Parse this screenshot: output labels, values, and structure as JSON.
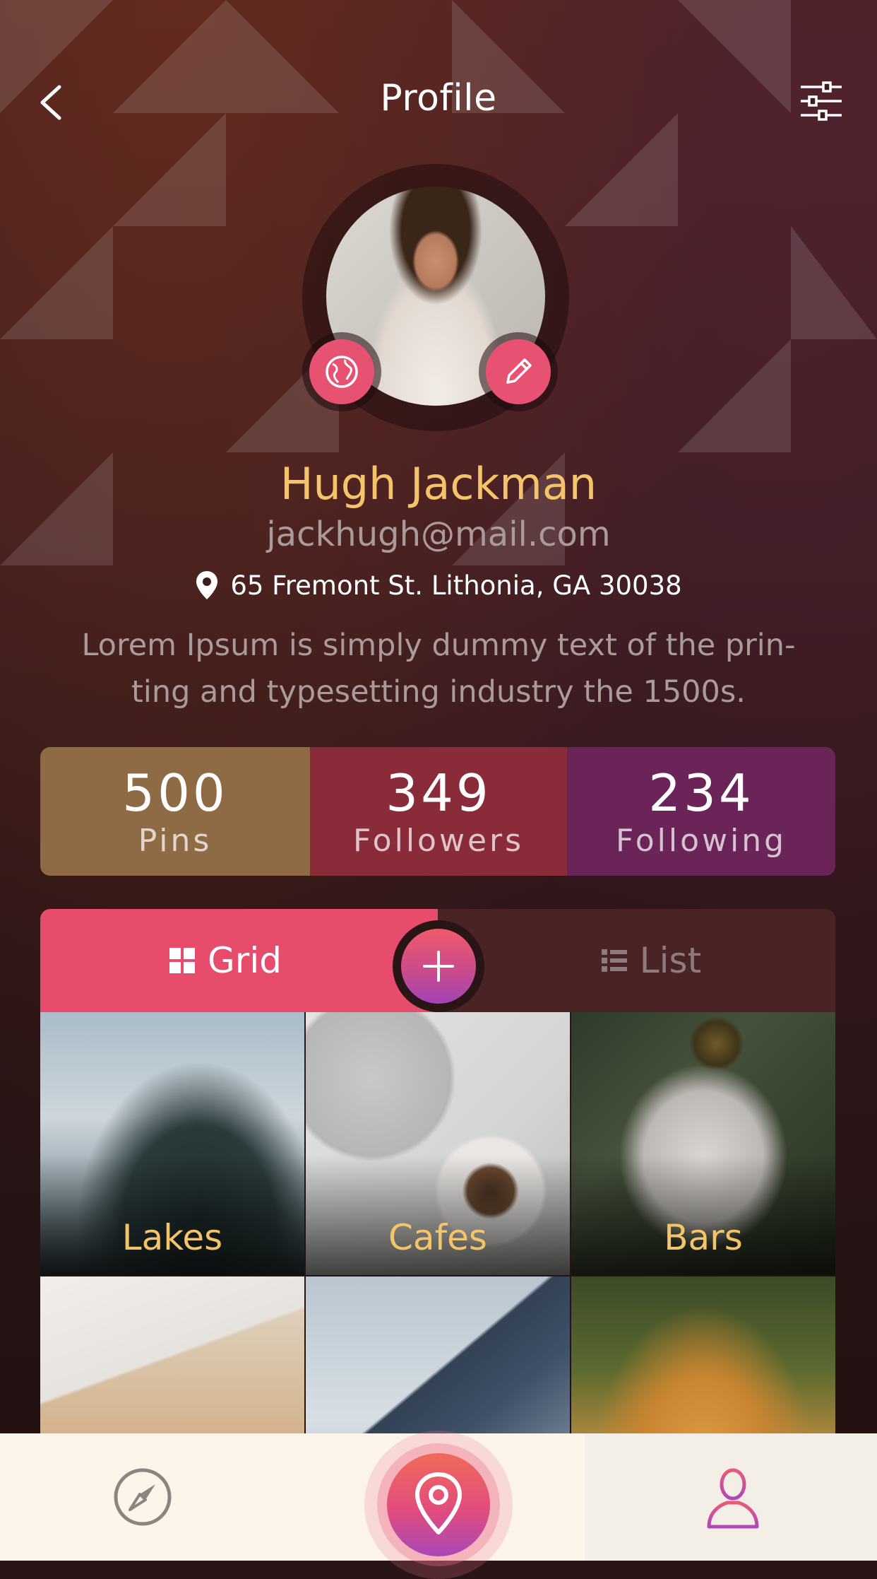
{
  "header": {
    "title": "Profile",
    "back_icon": "chevron-left-icon",
    "filter_icon": "sliders-icon"
  },
  "profile": {
    "name": "Hugh Jackman",
    "email": "jackhugh@mail.com",
    "address": "65 Fremont St. Lithonia, GA 30038",
    "bio": "Lorem Ipsum is simply dummy text of the prin-ting and typesetting industry the 1500s.",
    "avatar_buttons": [
      "globe-icon",
      "pencil-icon"
    ]
  },
  "stats": [
    {
      "value": "500",
      "label": "Pins",
      "color": "#8f6b45"
    },
    {
      "value": "349",
      "label": "Followers",
      "color": "#8a2b3a"
    },
    {
      "value": "234",
      "label": "Following",
      "color": "#6b2457"
    }
  ],
  "tabs": {
    "grid_label": "Grid",
    "list_label": "List",
    "active": "Grid",
    "active_color": "#e84c6c",
    "add_icon": "plus-icon"
  },
  "grid": [
    {
      "caption": "Lakes"
    },
    {
      "caption": "Cafes"
    },
    {
      "caption": "Bars"
    },
    {
      "caption": ""
    },
    {
      "caption": ""
    },
    {
      "caption": ""
    }
  ],
  "bottom_nav": {
    "items": [
      "compass-icon",
      "location-pin-icon",
      "user-icon"
    ],
    "active": "user-icon"
  },
  "colors": {
    "accent": "#e84c6c",
    "name_gold": "#f5c46a",
    "muted_text": "#a99b98"
  }
}
